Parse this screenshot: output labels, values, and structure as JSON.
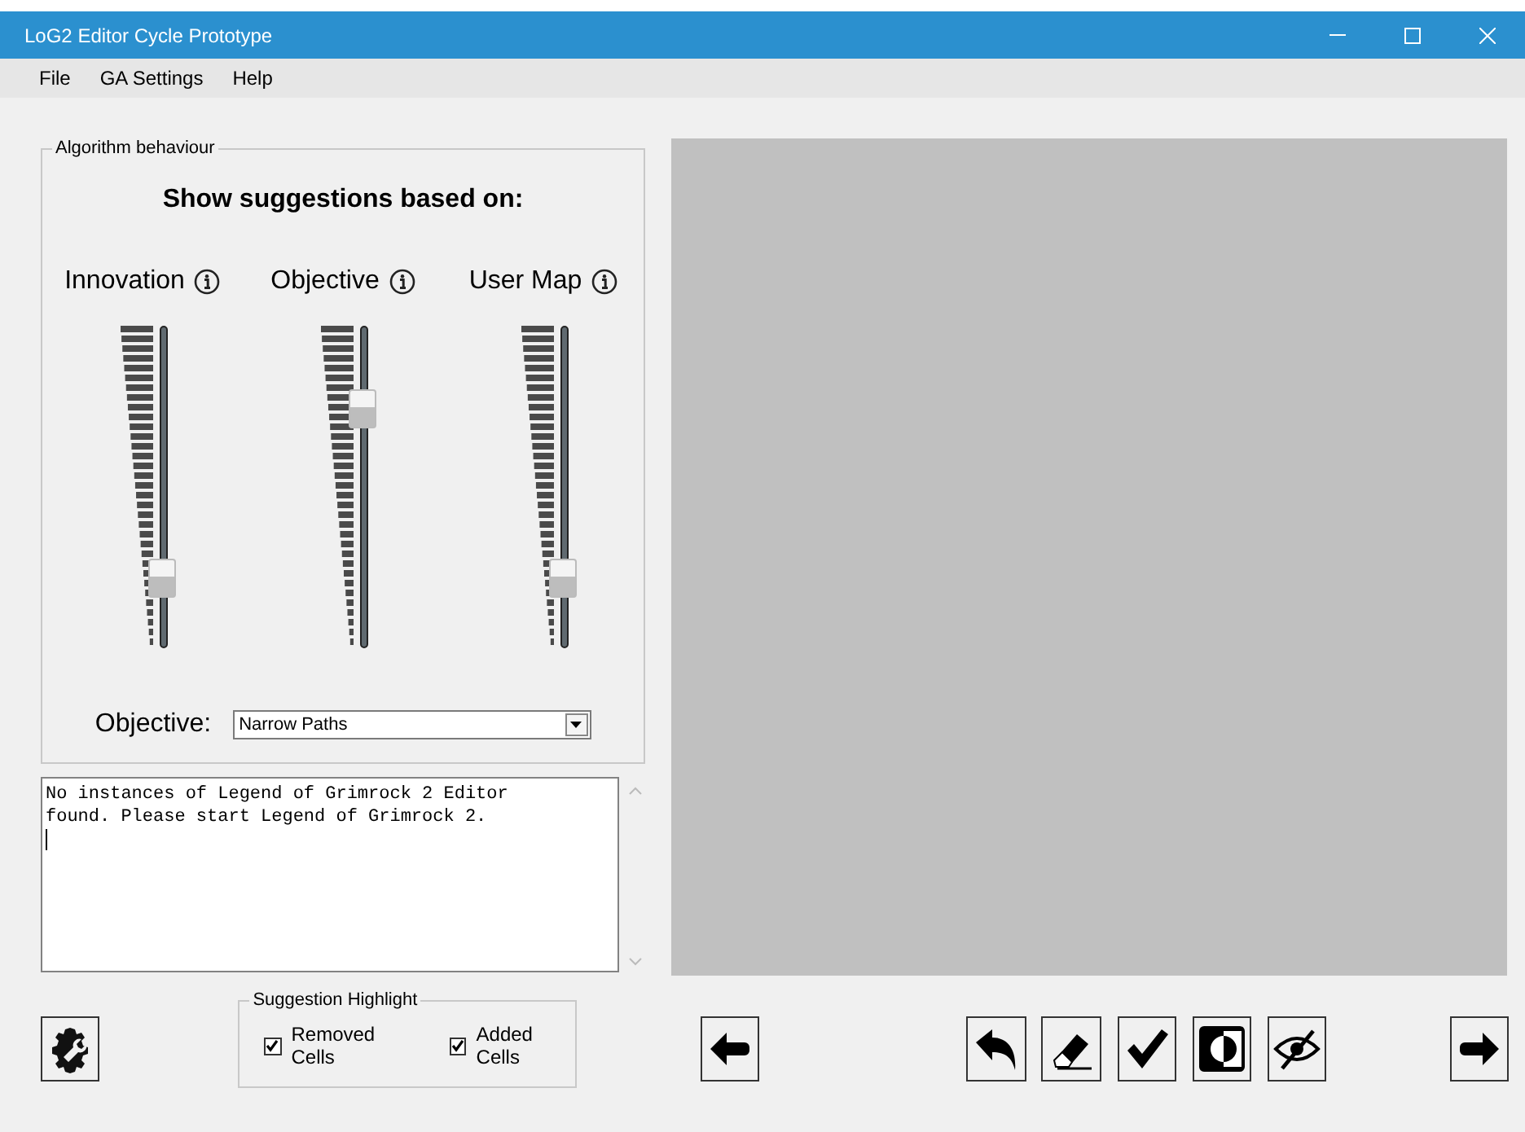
{
  "window": {
    "title": "LoG2 Editor Cycle Prototype"
  },
  "menu": [
    "File",
    "GA Settings",
    "Help"
  ],
  "algorithm_group": {
    "title": "Algorithm behaviour",
    "heading": "Show suggestions based on:",
    "sliders": [
      {
        "label": "Innovation",
        "level": 0.17
      },
      {
        "label": "Objective",
        "level": 0.77
      },
      {
        "label": "User Map",
        "level": 0.17
      }
    ],
    "objective_label": "Objective:",
    "objective_value": "Narrow Paths"
  },
  "log": {
    "lines": [
      "No instances of Legend of Grimrock 2 Editor",
      "found. Please start Legend of Grimrock 2."
    ]
  },
  "highlight_group": {
    "title": "Suggestion Highlight",
    "options": [
      {
        "label": "Removed Cells",
        "checked": true
      },
      {
        "label": "Added Cells",
        "checked": true
      }
    ]
  }
}
